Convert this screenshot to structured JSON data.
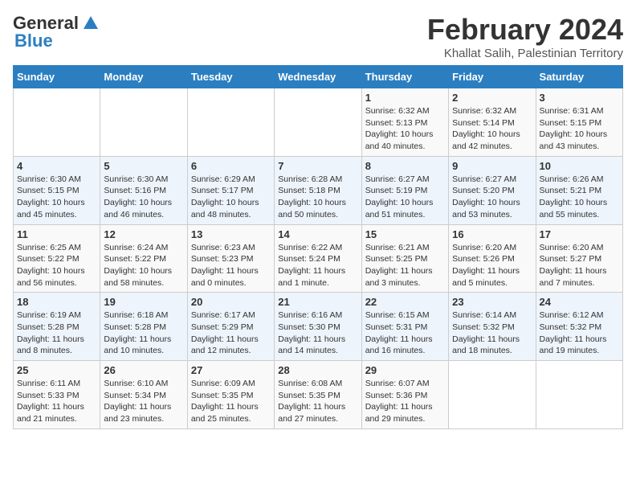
{
  "logo": {
    "line1": "General",
    "line2": "Blue"
  },
  "title": "February 2024",
  "subtitle": "Khallat Salih, Palestinian Territory",
  "days_of_week": [
    "Sunday",
    "Monday",
    "Tuesday",
    "Wednesday",
    "Thursday",
    "Friday",
    "Saturday"
  ],
  "weeks": [
    [
      {
        "day": "",
        "sunrise": "",
        "sunset": "",
        "daylight": ""
      },
      {
        "day": "",
        "sunrise": "",
        "sunset": "",
        "daylight": ""
      },
      {
        "day": "",
        "sunrise": "",
        "sunset": "",
        "daylight": ""
      },
      {
        "day": "",
        "sunrise": "",
        "sunset": "",
        "daylight": ""
      },
      {
        "day": "1",
        "sunrise": "Sunrise: 6:32 AM",
        "sunset": "Sunset: 5:13 PM",
        "daylight": "Daylight: 10 hours and 40 minutes."
      },
      {
        "day": "2",
        "sunrise": "Sunrise: 6:32 AM",
        "sunset": "Sunset: 5:14 PM",
        "daylight": "Daylight: 10 hours and 42 minutes."
      },
      {
        "day": "3",
        "sunrise": "Sunrise: 6:31 AM",
        "sunset": "Sunset: 5:15 PM",
        "daylight": "Daylight: 10 hours and 43 minutes."
      }
    ],
    [
      {
        "day": "4",
        "sunrise": "Sunrise: 6:30 AM",
        "sunset": "Sunset: 5:15 PM",
        "daylight": "Daylight: 10 hours and 45 minutes."
      },
      {
        "day": "5",
        "sunrise": "Sunrise: 6:30 AM",
        "sunset": "Sunset: 5:16 PM",
        "daylight": "Daylight: 10 hours and 46 minutes."
      },
      {
        "day": "6",
        "sunrise": "Sunrise: 6:29 AM",
        "sunset": "Sunset: 5:17 PM",
        "daylight": "Daylight: 10 hours and 48 minutes."
      },
      {
        "day": "7",
        "sunrise": "Sunrise: 6:28 AM",
        "sunset": "Sunset: 5:18 PM",
        "daylight": "Daylight: 10 hours and 50 minutes."
      },
      {
        "day": "8",
        "sunrise": "Sunrise: 6:27 AM",
        "sunset": "Sunset: 5:19 PM",
        "daylight": "Daylight: 10 hours and 51 minutes."
      },
      {
        "day": "9",
        "sunrise": "Sunrise: 6:27 AM",
        "sunset": "Sunset: 5:20 PM",
        "daylight": "Daylight: 10 hours and 53 minutes."
      },
      {
        "day": "10",
        "sunrise": "Sunrise: 6:26 AM",
        "sunset": "Sunset: 5:21 PM",
        "daylight": "Daylight: 10 hours and 55 minutes."
      }
    ],
    [
      {
        "day": "11",
        "sunrise": "Sunrise: 6:25 AM",
        "sunset": "Sunset: 5:22 PM",
        "daylight": "Daylight: 10 hours and 56 minutes."
      },
      {
        "day": "12",
        "sunrise": "Sunrise: 6:24 AM",
        "sunset": "Sunset: 5:22 PM",
        "daylight": "Daylight: 10 hours and 58 minutes."
      },
      {
        "day": "13",
        "sunrise": "Sunrise: 6:23 AM",
        "sunset": "Sunset: 5:23 PM",
        "daylight": "Daylight: 11 hours and 0 minutes."
      },
      {
        "day": "14",
        "sunrise": "Sunrise: 6:22 AM",
        "sunset": "Sunset: 5:24 PM",
        "daylight": "Daylight: 11 hours and 1 minute."
      },
      {
        "day": "15",
        "sunrise": "Sunrise: 6:21 AM",
        "sunset": "Sunset: 5:25 PM",
        "daylight": "Daylight: 11 hours and 3 minutes."
      },
      {
        "day": "16",
        "sunrise": "Sunrise: 6:20 AM",
        "sunset": "Sunset: 5:26 PM",
        "daylight": "Daylight: 11 hours and 5 minutes."
      },
      {
        "day": "17",
        "sunrise": "Sunrise: 6:20 AM",
        "sunset": "Sunset: 5:27 PM",
        "daylight": "Daylight: 11 hours and 7 minutes."
      }
    ],
    [
      {
        "day": "18",
        "sunrise": "Sunrise: 6:19 AM",
        "sunset": "Sunset: 5:28 PM",
        "daylight": "Daylight: 11 hours and 8 minutes."
      },
      {
        "day": "19",
        "sunrise": "Sunrise: 6:18 AM",
        "sunset": "Sunset: 5:28 PM",
        "daylight": "Daylight: 11 hours and 10 minutes."
      },
      {
        "day": "20",
        "sunrise": "Sunrise: 6:17 AM",
        "sunset": "Sunset: 5:29 PM",
        "daylight": "Daylight: 11 hours and 12 minutes."
      },
      {
        "day": "21",
        "sunrise": "Sunrise: 6:16 AM",
        "sunset": "Sunset: 5:30 PM",
        "daylight": "Daylight: 11 hours and 14 minutes."
      },
      {
        "day": "22",
        "sunrise": "Sunrise: 6:15 AM",
        "sunset": "Sunset: 5:31 PM",
        "daylight": "Daylight: 11 hours and 16 minutes."
      },
      {
        "day": "23",
        "sunrise": "Sunrise: 6:14 AM",
        "sunset": "Sunset: 5:32 PM",
        "daylight": "Daylight: 11 hours and 18 minutes."
      },
      {
        "day": "24",
        "sunrise": "Sunrise: 6:12 AM",
        "sunset": "Sunset: 5:32 PM",
        "daylight": "Daylight: 11 hours and 19 minutes."
      }
    ],
    [
      {
        "day": "25",
        "sunrise": "Sunrise: 6:11 AM",
        "sunset": "Sunset: 5:33 PM",
        "daylight": "Daylight: 11 hours and 21 minutes."
      },
      {
        "day": "26",
        "sunrise": "Sunrise: 6:10 AM",
        "sunset": "Sunset: 5:34 PM",
        "daylight": "Daylight: 11 hours and 23 minutes."
      },
      {
        "day": "27",
        "sunrise": "Sunrise: 6:09 AM",
        "sunset": "Sunset: 5:35 PM",
        "daylight": "Daylight: 11 hours and 25 minutes."
      },
      {
        "day": "28",
        "sunrise": "Sunrise: 6:08 AM",
        "sunset": "Sunset: 5:35 PM",
        "daylight": "Daylight: 11 hours and 27 minutes."
      },
      {
        "day": "29",
        "sunrise": "Sunrise: 6:07 AM",
        "sunset": "Sunset: 5:36 PM",
        "daylight": "Daylight: 11 hours and 29 minutes."
      },
      {
        "day": "",
        "sunrise": "",
        "sunset": "",
        "daylight": ""
      },
      {
        "day": "",
        "sunrise": "",
        "sunset": "",
        "daylight": ""
      }
    ]
  ]
}
